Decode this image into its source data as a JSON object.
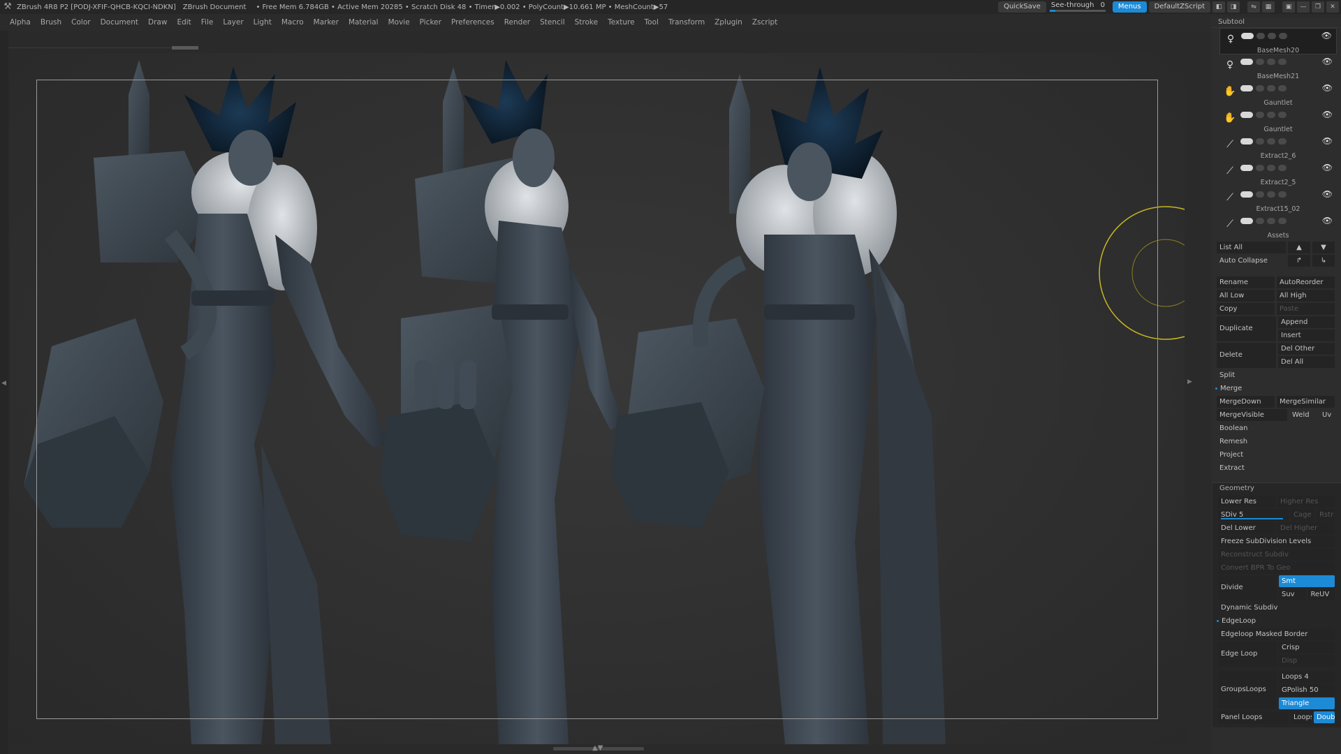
{
  "titlebar": {
    "app": "ZBrush 4R8 P2 [PODJ-XFIF-QHCB-KQCI-NDKN]",
    "document": "ZBrush Document",
    "stats": "• Free Mem 6.784GB • Active Mem 20285 • Scratch Disk 48 • Timer▶0.002 • PolyCount▶10.661 MP • MeshCount▶57",
    "quicksave": "QuickSave",
    "see_through_label": "See-through",
    "see_through_value": "0",
    "see_through_fraction": 0.1,
    "menus": "Menus",
    "zscript": "DefaultZScript"
  },
  "menubar": [
    "Alpha",
    "Brush",
    "Color",
    "Document",
    "Draw",
    "Edit",
    "File",
    "Layer",
    "Light",
    "Macro",
    "Marker",
    "Material",
    "Movie",
    "Picker",
    "Preferences",
    "Render",
    "Stencil",
    "Stroke",
    "Texture",
    "Tool",
    "Transform",
    "Zplugin",
    "Zscript"
  ],
  "subtool": {
    "header": "Subtool",
    "items": [
      {
        "name": "BaseMesh20",
        "icon": "figure-icon"
      },
      {
        "name": "BaseMesh21",
        "icon": "figure-icon"
      },
      {
        "name": "Gauntlet",
        "icon": "gauntlet-icon"
      },
      {
        "name": "Gauntlet",
        "icon": "gauntlet-icon"
      },
      {
        "name": "Extract2_6",
        "icon": "mesh-icon"
      },
      {
        "name": "Extract2_5",
        "icon": "mesh-icon"
      },
      {
        "name": "Extract15_02",
        "icon": "mesh-icon"
      },
      {
        "name": "Assets",
        "icon": "mesh-icon"
      }
    ],
    "list_all": "List All",
    "auto_collapse": "Auto Collapse",
    "rename": "Rename",
    "autoreorder": "AutoReorder",
    "all_low": "All Low",
    "all_high": "All High",
    "copy": "Copy",
    "paste": "Paste",
    "duplicate": "Duplicate",
    "append": "Append",
    "insert": "Insert",
    "delete": "Delete",
    "del_other": "Del Other",
    "del_all": "Del All",
    "split": "Split",
    "merge": "Merge",
    "mergedown": "MergeDown",
    "mergesimilar": "MergeSimilar",
    "mergevisible": "MergeVisible",
    "weld": "Weld",
    "uv": "Uv",
    "boolean": "Boolean",
    "remesh": "Remesh",
    "project": "Project",
    "extract": "Extract"
  },
  "geometry": {
    "header": "Geometry",
    "lower_res": "Lower Res",
    "higher_res": "Higher Res",
    "sdiv_label": "SDiv",
    "sdiv_value": "5",
    "sdiv_fraction": 1.0,
    "cage": "Cage",
    "rstr": "Rstr",
    "del_lower": "Del Lower",
    "del_higher": "Del Higher",
    "freeze": "Freeze SubDivision Levels",
    "reconstruct": "Reconstruct Subdiv",
    "convert_bpr": "Convert BPR To Geo",
    "divide": "Divide",
    "smt": "Smt",
    "suv": "Suv",
    "reuv": "ReUV",
    "dynamic_subdiv": "Dynamic Subdiv",
    "edgeloop": "EdgeLoop",
    "edgeloop_masked": "Edgeloop Masked Border",
    "edge_loop": "Edge Loop",
    "crisp": "Crisp",
    "disp": "Disp",
    "groupsloops": "GroupsLoops",
    "loops_label": "Loops",
    "loops_value": "4",
    "gpolish_label": "GPolish",
    "gpolish_value": "50",
    "triangle": "Triangle",
    "panel_loops": "Panel Loops",
    "loops2_label": "Loops",
    "double": "Double"
  },
  "colors": {
    "accent": "#1d8ad6",
    "background": "#2a2a2a",
    "model": "#3d4650",
    "hair": "#102233",
    "fur": "#c9cdd0",
    "gizmo": "#c8b820"
  }
}
